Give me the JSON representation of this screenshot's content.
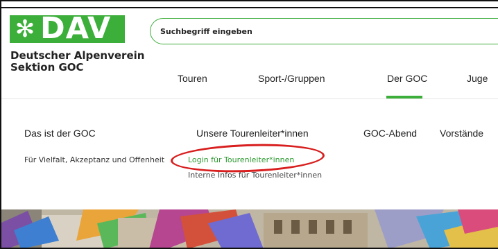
{
  "logo": {
    "word": "DAV",
    "org_line1": "Deutscher Alpenverein",
    "org_line2": "Sektion GOC"
  },
  "search": {
    "placeholder": "Suchbegriff eingeben"
  },
  "main_nav": {
    "items": [
      {
        "label": "Touren"
      },
      {
        "label": "Sport-/Gruppen"
      },
      {
        "label": "Der GOC",
        "active": true
      },
      {
        "label": "Juge"
      }
    ]
  },
  "submenu": {
    "col1_title": "Das ist der GOC",
    "col1_sub": "Für Vielfalt, Akzeptanz und Offenheit",
    "col2_title": "Unsere Tourenleiter*innen",
    "col2_link": "Login für Tourenleiter*innen",
    "col2_sub": "Interne Infos für Tourenleiter*innen",
    "col3_title": "GOC-Abend",
    "col4_title": "Vorstände"
  },
  "colors": {
    "brand_green": "#3cae3a",
    "annotation_red": "#d81e1e"
  }
}
